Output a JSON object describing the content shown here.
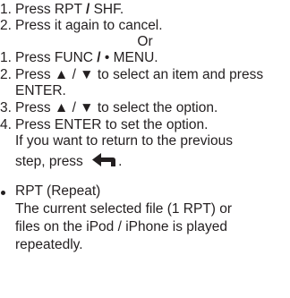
{
  "section_a": {
    "items": [
      {
        "num": "1.",
        "pre": "Press RPT ",
        "sep": "/",
        "post": " SHF."
      },
      {
        "num": "2.",
        "text": "Press it again to cancel."
      }
    ]
  },
  "divider": "Or",
  "section_b": {
    "items": [
      {
        "num": "1.",
        "pre": "Press FUNC ",
        "sep": "/",
        "post": " • MENU."
      },
      {
        "num": "2.",
        "line1": "Press ▲ / ▼ to select an item and press",
        "line2": "ENTER."
      },
      {
        "num": "3.",
        "text": "Press ▲ / ▼ to select the option."
      },
      {
        "num": "4.",
        "line1": "Press ENTER to set the option.",
        "line2": "If you want to return to the previous",
        "line3_pre": "step, press ",
        "line3_post": "."
      }
    ],
    "return_icon": "return-arrow-icon"
  },
  "bullet": {
    "title": "RPT (Repeat)",
    "lines": [
      "The current selected file (1 RPT) or",
      "files on the iPod / iPhone is played",
      "repeatedly."
    ]
  }
}
